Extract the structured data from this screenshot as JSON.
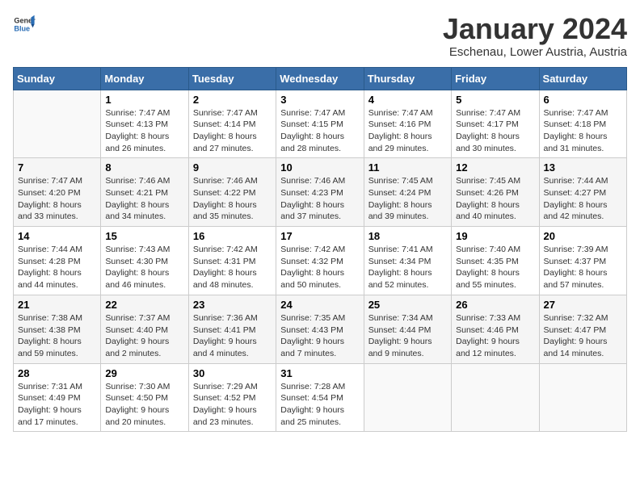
{
  "header": {
    "logo_general": "General",
    "logo_blue": "Blue",
    "title": "January 2024",
    "subtitle": "Eschenau, Lower Austria, Austria"
  },
  "calendar": {
    "columns": [
      "Sunday",
      "Monday",
      "Tuesday",
      "Wednesday",
      "Thursday",
      "Friday",
      "Saturday"
    ],
    "rows": [
      [
        {
          "day": "",
          "detail": ""
        },
        {
          "day": "1",
          "detail": "Sunrise: 7:47 AM\nSunset: 4:13 PM\nDaylight: 8 hours\nand 26 minutes."
        },
        {
          "day": "2",
          "detail": "Sunrise: 7:47 AM\nSunset: 4:14 PM\nDaylight: 8 hours\nand 27 minutes."
        },
        {
          "day": "3",
          "detail": "Sunrise: 7:47 AM\nSunset: 4:15 PM\nDaylight: 8 hours\nand 28 minutes."
        },
        {
          "day": "4",
          "detail": "Sunrise: 7:47 AM\nSunset: 4:16 PM\nDaylight: 8 hours\nand 29 minutes."
        },
        {
          "day": "5",
          "detail": "Sunrise: 7:47 AM\nSunset: 4:17 PM\nDaylight: 8 hours\nand 30 minutes."
        },
        {
          "day": "6",
          "detail": "Sunrise: 7:47 AM\nSunset: 4:18 PM\nDaylight: 8 hours\nand 31 minutes."
        }
      ],
      [
        {
          "day": "7",
          "detail": "Sunrise: 7:47 AM\nSunset: 4:20 PM\nDaylight: 8 hours\nand 33 minutes."
        },
        {
          "day": "8",
          "detail": "Sunrise: 7:46 AM\nSunset: 4:21 PM\nDaylight: 8 hours\nand 34 minutes."
        },
        {
          "day": "9",
          "detail": "Sunrise: 7:46 AM\nSunset: 4:22 PM\nDaylight: 8 hours\nand 35 minutes."
        },
        {
          "day": "10",
          "detail": "Sunrise: 7:46 AM\nSunset: 4:23 PM\nDaylight: 8 hours\nand 37 minutes."
        },
        {
          "day": "11",
          "detail": "Sunrise: 7:45 AM\nSunset: 4:24 PM\nDaylight: 8 hours\nand 39 minutes."
        },
        {
          "day": "12",
          "detail": "Sunrise: 7:45 AM\nSunset: 4:26 PM\nDaylight: 8 hours\nand 40 minutes."
        },
        {
          "day": "13",
          "detail": "Sunrise: 7:44 AM\nSunset: 4:27 PM\nDaylight: 8 hours\nand 42 minutes."
        }
      ],
      [
        {
          "day": "14",
          "detail": "Sunrise: 7:44 AM\nSunset: 4:28 PM\nDaylight: 8 hours\nand 44 minutes."
        },
        {
          "day": "15",
          "detail": "Sunrise: 7:43 AM\nSunset: 4:30 PM\nDaylight: 8 hours\nand 46 minutes."
        },
        {
          "day": "16",
          "detail": "Sunrise: 7:42 AM\nSunset: 4:31 PM\nDaylight: 8 hours\nand 48 minutes."
        },
        {
          "day": "17",
          "detail": "Sunrise: 7:42 AM\nSunset: 4:32 PM\nDaylight: 8 hours\nand 50 minutes."
        },
        {
          "day": "18",
          "detail": "Sunrise: 7:41 AM\nSunset: 4:34 PM\nDaylight: 8 hours\nand 52 minutes."
        },
        {
          "day": "19",
          "detail": "Sunrise: 7:40 AM\nSunset: 4:35 PM\nDaylight: 8 hours\nand 55 minutes."
        },
        {
          "day": "20",
          "detail": "Sunrise: 7:39 AM\nSunset: 4:37 PM\nDaylight: 8 hours\nand 57 minutes."
        }
      ],
      [
        {
          "day": "21",
          "detail": "Sunrise: 7:38 AM\nSunset: 4:38 PM\nDaylight: 8 hours\nand 59 minutes."
        },
        {
          "day": "22",
          "detail": "Sunrise: 7:37 AM\nSunset: 4:40 PM\nDaylight: 9 hours\nand 2 minutes."
        },
        {
          "day": "23",
          "detail": "Sunrise: 7:36 AM\nSunset: 4:41 PM\nDaylight: 9 hours\nand 4 minutes."
        },
        {
          "day": "24",
          "detail": "Sunrise: 7:35 AM\nSunset: 4:43 PM\nDaylight: 9 hours\nand 7 minutes."
        },
        {
          "day": "25",
          "detail": "Sunrise: 7:34 AM\nSunset: 4:44 PM\nDaylight: 9 hours\nand 9 minutes."
        },
        {
          "day": "26",
          "detail": "Sunrise: 7:33 AM\nSunset: 4:46 PM\nDaylight: 9 hours\nand 12 minutes."
        },
        {
          "day": "27",
          "detail": "Sunrise: 7:32 AM\nSunset: 4:47 PM\nDaylight: 9 hours\nand 14 minutes."
        }
      ],
      [
        {
          "day": "28",
          "detail": "Sunrise: 7:31 AM\nSunset: 4:49 PM\nDaylight: 9 hours\nand 17 minutes."
        },
        {
          "day": "29",
          "detail": "Sunrise: 7:30 AM\nSunset: 4:50 PM\nDaylight: 9 hours\nand 20 minutes."
        },
        {
          "day": "30",
          "detail": "Sunrise: 7:29 AM\nSunset: 4:52 PM\nDaylight: 9 hours\nand 23 minutes."
        },
        {
          "day": "31",
          "detail": "Sunrise: 7:28 AM\nSunset: 4:54 PM\nDaylight: 9 hours\nand 25 minutes."
        },
        {
          "day": "",
          "detail": ""
        },
        {
          "day": "",
          "detail": ""
        },
        {
          "day": "",
          "detail": ""
        }
      ]
    ]
  }
}
